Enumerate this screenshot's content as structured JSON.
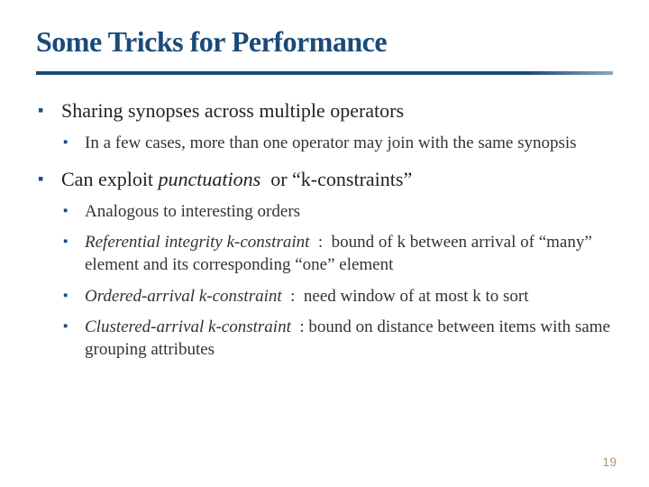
{
  "title": "Some Tricks for Performance",
  "b1": {
    "head": "Sharing synopses across multiple operators",
    "sub1": "In a few cases, more than one operator may join with the same synopsis"
  },
  "b2": {
    "pre": "Can exploit ",
    "em": "punctuations",
    "post": "  or “k-constraints”",
    "s1": "Analogous to interesting orders",
    "s2_em": "Referential integrity k-constraint",
    "s2_rest": "  :  bound of k between arrival of “many” element and its corresponding “one” element",
    "s3_em": "Ordered-arrival k-constraint",
    "s3_rest": "  :  need window of at most k to sort",
    "s4_em": "Clustered-arrival k-constraint",
    "s4_rest": "  : bound on distance between items with same grouping attributes"
  },
  "page": "19"
}
